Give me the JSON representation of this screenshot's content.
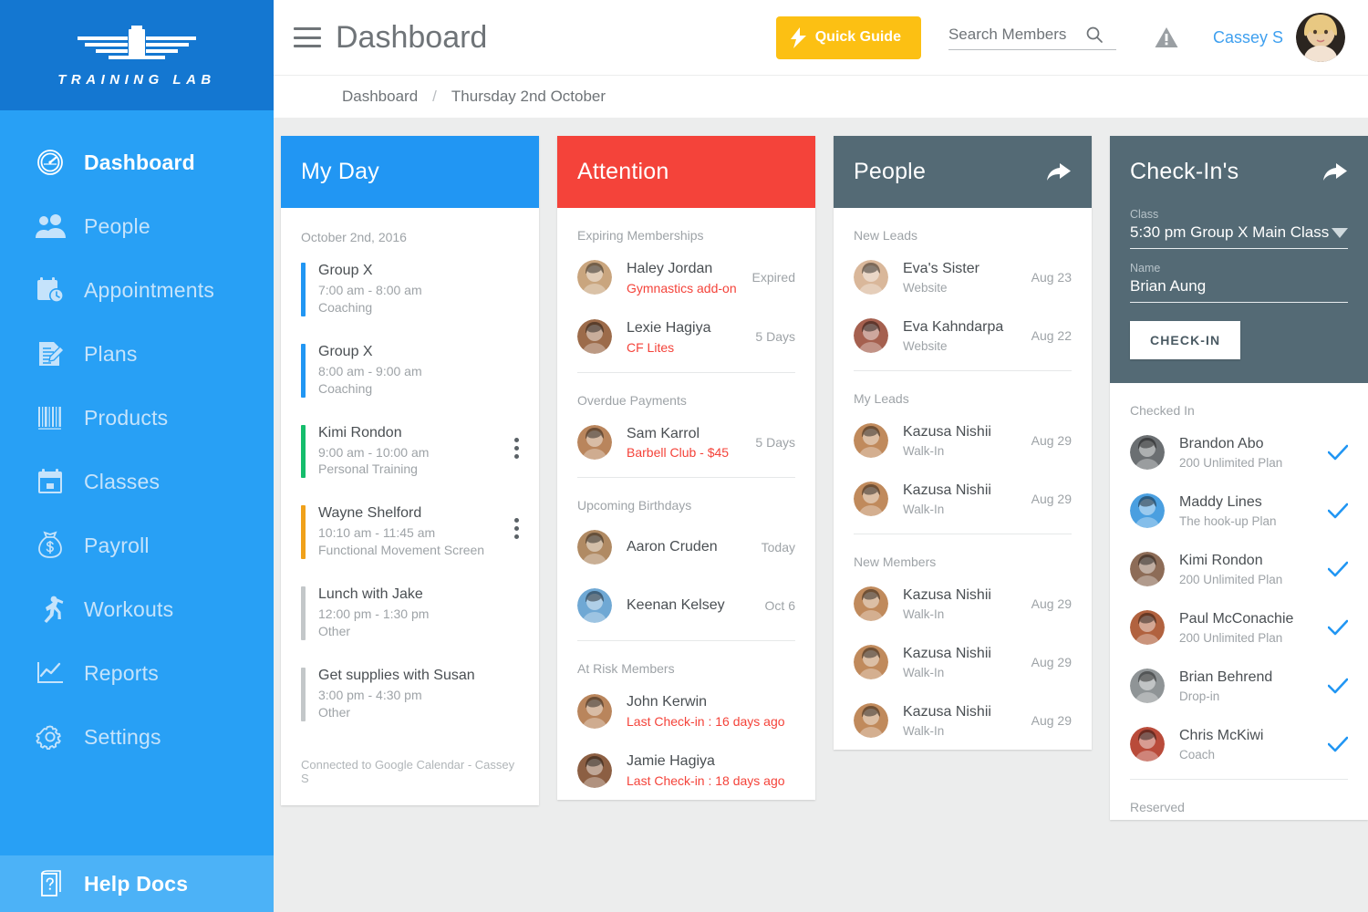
{
  "brand": {
    "name": "TRAINING LAB",
    "logo_icon": "wings-logo-icon"
  },
  "sidebar": {
    "items": [
      {
        "label": "Dashboard",
        "icon": "speedometer-icon",
        "active": true
      },
      {
        "label": "People",
        "icon": "people-icon",
        "active": false
      },
      {
        "label": "Appointments",
        "icon": "calendar-clock-icon",
        "active": false
      },
      {
        "label": "Plans",
        "icon": "document-pencil-icon",
        "active": false
      },
      {
        "label": "Products",
        "icon": "barcode-icon",
        "active": false
      },
      {
        "label": "Classes",
        "icon": "calendar-icon",
        "active": false
      },
      {
        "label": "Payroll",
        "icon": "money-bag-icon",
        "active": false
      },
      {
        "label": "Workouts",
        "icon": "running-person-icon",
        "active": false
      },
      {
        "label": "Reports",
        "icon": "line-chart-icon",
        "active": false
      },
      {
        "label": "Settings",
        "icon": "gear-icon",
        "active": false
      }
    ],
    "help": {
      "label": "Help Docs",
      "icon": "help-book-icon"
    }
  },
  "topbar": {
    "menu_icon": "hamburger-icon",
    "title": "Dashboard",
    "quick_guide_label": "Quick Guide",
    "quick_guide_icon": "lightning-bolt-icon",
    "search_placeholder": "Search Members",
    "search_value": "",
    "search_icon": "search-icon",
    "alert_icon": "warning-triangle-icon",
    "user_name": "Cassey S",
    "avatar_icon": "user-avatar"
  },
  "breadcrumb": {
    "root": "Dashboard",
    "separator": "/",
    "current": "Thursday 2nd October"
  },
  "colors": {
    "sidebar": "#28a0f5",
    "brand_bar": "#1477d1",
    "my_day_header": "#2196f3",
    "attention_header": "#f4433a",
    "slate_header": "#546a75",
    "quick_guide": "#fcc013",
    "accent_link": "#3fa0ef",
    "check_tick": "#2196f3",
    "danger_text": "#f4433a"
  },
  "my_day": {
    "title": "My Day",
    "date": "October 2nd, 2016",
    "footer": "Connected to Google Calendar - Cassey S",
    "events": [
      {
        "title": "Group X",
        "time": "7:00 am - 8:00 am",
        "type": "Coaching",
        "color": "#2196f3",
        "menu": false
      },
      {
        "title": "Group X",
        "time": "8:00 am - 9:00 am",
        "type": "Coaching",
        "color": "#2196f3",
        "menu": false
      },
      {
        "title": "Kimi Rondon",
        "time": "9:00 am - 10:00 am",
        "type": "Personal Training",
        "color": "#15bd6c",
        "menu": true
      },
      {
        "title": "Wayne Shelford",
        "time": "10:10 am - 11:45 am",
        "type": "Functional Movement Screen",
        "color": "#f0a11a",
        "menu": true
      },
      {
        "title": "Lunch with Jake",
        "time": "12:00 pm - 1:30 pm",
        "type": "Other",
        "color": "#c3c7c9",
        "menu": false
      },
      {
        "title": "Get supplies with Susan",
        "time": "3:00 pm - 4:30 pm",
        "type": "Other",
        "color": "#c3c7c9",
        "menu": false
      }
    ]
  },
  "attention": {
    "title": "Attention",
    "sections": [
      {
        "label": "Expiring Memberships",
        "rows": [
          {
            "name": "Haley Jordan",
            "sub": "Gymnastics add-on",
            "sub_warn": true,
            "meta": "Expired",
            "avatar": "#c9a57e"
          },
          {
            "name": "Lexie Hagiya",
            "sub": "CF Lites",
            "sub_warn": true,
            "meta": "5 Days",
            "avatar": "#9c6b4a"
          }
        ]
      },
      {
        "label": "Overdue Payments",
        "rows": [
          {
            "name": "Sam Karrol",
            "sub": "Barbell Club - $45",
            "sub_warn": true,
            "meta": "5 Days",
            "avatar": "#b9855c"
          }
        ]
      },
      {
        "label": "Upcoming Birthdays",
        "rows": [
          {
            "name": "Aaron Cruden",
            "sub": "",
            "sub_warn": false,
            "meta": "Today",
            "avatar": "#b08a63"
          },
          {
            "name": "Keenan Kelsey",
            "sub": "",
            "sub_warn": false,
            "meta": "Oct 6",
            "avatar": "#6fa8d4"
          }
        ]
      },
      {
        "label": "At Risk Members",
        "rows": [
          {
            "name": "John Kerwin",
            "sub": "Last Check-in : 16 days ago",
            "sub_warn": true,
            "meta": "",
            "avatar": "#b9855c"
          },
          {
            "name": "Jamie Hagiya",
            "sub": "Last Check-in : 18 days ago",
            "sub_warn": true,
            "meta": "",
            "avatar": "#8c5f43"
          }
        ]
      }
    ]
  },
  "people": {
    "title": "People",
    "share_icon": "share-arrow-icon",
    "sections": [
      {
        "label": "New Leads",
        "rows": [
          {
            "name": "Eva's Sister",
            "sub": "Website",
            "meta": "Aug 23",
            "avatar": "#d9b79a"
          },
          {
            "name": "Eva Kahndarpa",
            "sub": "Website",
            "meta": "Aug 22",
            "avatar": "#a5604f"
          }
        ]
      },
      {
        "label": "My Leads",
        "rows": [
          {
            "name": "Kazusa Nishii",
            "sub": "Walk-In",
            "meta": "Aug 29",
            "avatar": "#c08a5c"
          },
          {
            "name": "Kazusa Nishii",
            "sub": "Walk-In",
            "meta": "Aug 29",
            "avatar": "#c08a5c"
          }
        ]
      },
      {
        "label": "New Members",
        "rows": [
          {
            "name": "Kazusa Nishii",
            "sub": "Walk-In",
            "meta": "Aug 29",
            "avatar": "#c08a5c"
          },
          {
            "name": "Kazusa Nishii",
            "sub": "Walk-In",
            "meta": "Aug 29",
            "avatar": "#c08a5c"
          },
          {
            "name": "Kazusa Nishii",
            "sub": "Walk-In",
            "meta": "Aug 29",
            "avatar": "#c08a5c"
          }
        ]
      }
    ]
  },
  "checkins": {
    "title": "Check-In's",
    "share_icon": "share-arrow-icon",
    "class_label": "Class",
    "class_value": "5:30 pm Group X  Main Class",
    "class_caret_icon": "chevron-down-icon",
    "name_label": "Name",
    "name_value": "Brian Aung",
    "button_label": "CHECK-IN",
    "sections": [
      {
        "label": "Checked In",
        "rows": [
          {
            "name": "Brandon Abo",
            "sub": "200 Unlimited Plan",
            "checked": true,
            "avatar": "#6b6f72"
          },
          {
            "name": "Maddy Lines",
            "sub": "The hook-up Plan",
            "checked": true,
            "avatar": "#4a9fe0"
          },
          {
            "name": "Kimi Rondon",
            "sub": "200 Unlimited Plan",
            "checked": true,
            "avatar": "#8d6c57"
          },
          {
            "name": "Paul McConachie",
            "sub": "200 Unlimited Plan",
            "checked": true,
            "avatar": "#b1623f"
          },
          {
            "name": "Brian Behrend",
            "sub": "Drop-in",
            "checked": true,
            "avatar": "#8f9496"
          },
          {
            "name": "Chris McKiwi",
            "sub": "Coach",
            "checked": true,
            "avatar": "#b94b3a"
          }
        ]
      },
      {
        "label": "Reserved",
        "rows": []
      }
    ]
  }
}
